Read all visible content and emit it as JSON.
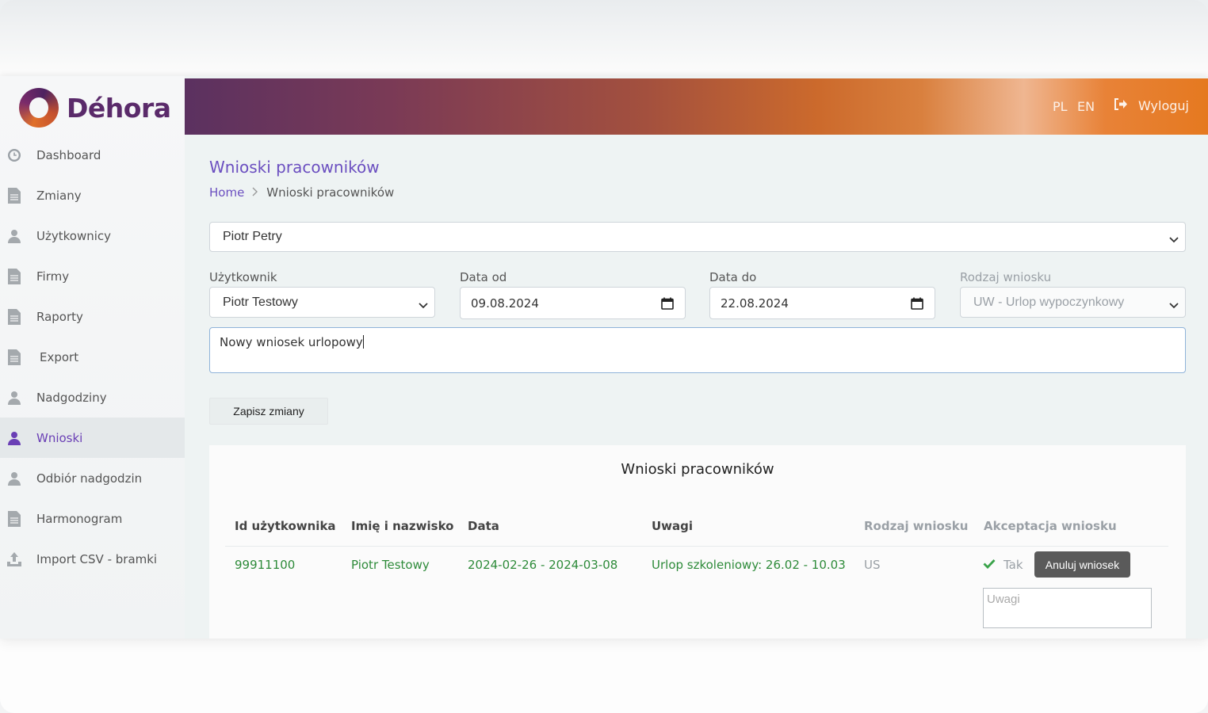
{
  "brand": {
    "name": "Déhora"
  },
  "header": {
    "lang_pl": "PL",
    "lang_en": "EN",
    "logout_label": "Wyloguj"
  },
  "sidebar": {
    "items": [
      {
        "label": "Dashboard",
        "icon": "clock-icon"
      },
      {
        "label": "Zmiany",
        "icon": "document-icon"
      },
      {
        "label": "Użytkownicy",
        "icon": "user-icon"
      },
      {
        "label": "Firmy",
        "icon": "document-icon"
      },
      {
        "label": "Raporty",
        "icon": "document-icon"
      },
      {
        "label": "Export",
        "icon": "document-icon"
      },
      {
        "label": "Nadgodziny",
        "icon": "user-icon"
      },
      {
        "label": "Wnioski",
        "icon": "user-icon",
        "active": true
      },
      {
        "label": "Odbiór nadgodzin",
        "icon": "user-icon"
      },
      {
        "label": "Harmonogram",
        "icon": "document-icon"
      },
      {
        "label": "Import CSV - bramki",
        "icon": "upload-icon"
      }
    ]
  },
  "page": {
    "title": "Wnioski pracowników",
    "breadcrumb": {
      "home": "Home",
      "current": "Wnioski pracowników"
    }
  },
  "form": {
    "employee_select": "Piotr Petry",
    "user_label": "Użytkownik",
    "user_value": "Piotr Testowy",
    "date_from_label": "Data od",
    "date_from_value": "09.08.2024",
    "date_to_label": "Data do",
    "date_to_value": "22.08.2024",
    "type_label": "Rodzaj wniosku",
    "type_value": "UW - Urlop wypoczynkowy",
    "note_value": "Nowy wniosek urlopowy",
    "save_label": "Zapisz zmiany"
  },
  "table": {
    "title": "Wnioski pracowników",
    "headers": [
      "Id użytkownika",
      "Imię i nazwisko",
      "Data",
      "Uwagi",
      "Rodzaj wniosku",
      "Akceptacja wniosku"
    ],
    "rows": [
      {
        "id": "99911100",
        "name": "Piotr Testowy",
        "date": "2024-02-26 - 2024-03-08",
        "note": "Urlop szkoleniowy: 26.02 - 10.03",
        "type": "US",
        "accepted": "Tak",
        "cancel_label": "Anuluj wniosek",
        "remarks_placeholder": "Uwagi"
      }
    ]
  },
  "colors": {
    "accent": "#6b4fc0",
    "success": "#2e8b3a",
    "muted": "#9aa0a6"
  }
}
